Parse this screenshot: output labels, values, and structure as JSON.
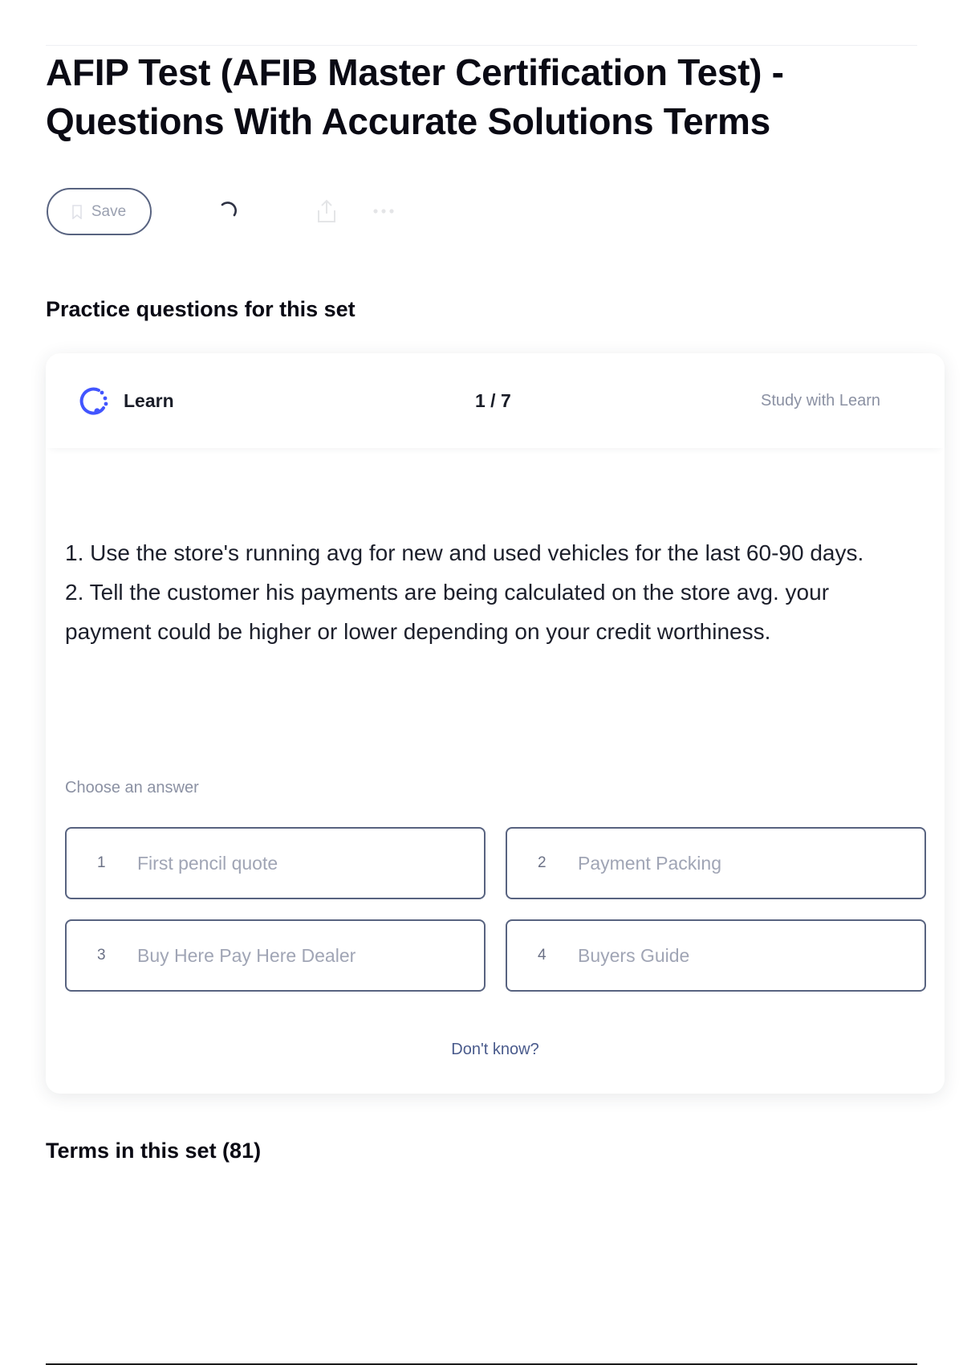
{
  "set": {
    "title": "AFIP Test (AFIB Master Certification Test) - Questions With Accurate Solutions Terms"
  },
  "toolbar": {
    "save_label": "Save"
  },
  "practice": {
    "heading": "Practice questions for this set",
    "mode_label": "Learn",
    "progress": "1 / 7",
    "study_link": "Study with Learn",
    "question": "1. Use the store's running avg for new and used vehicles for the last 60-90 days.\n2. Tell the customer his payments are being calculated on the store avg. your payment could be higher or lower depending on your credit worthiness.",
    "choose_label": "Choose an answer",
    "answers": [
      {
        "number": "1",
        "text": "First pencil quote"
      },
      {
        "number": "2",
        "text": "Payment Packing"
      },
      {
        "number": "3",
        "text": "Buy Here Pay Here Dealer"
      },
      {
        "number": "4",
        "text": "Buyers Guide"
      }
    ],
    "dont_know": "Don't know?"
  },
  "terms": {
    "heading": "Terms in this set (81)"
  },
  "colors": {
    "accent": "#4255ff",
    "border": "#586380",
    "muted_text": "#8b91a3",
    "link": "#4a5b8c"
  },
  "icons": [
    "bookmark-icon",
    "loading-icon",
    "share-icon",
    "more-icon",
    "learn-mode-icon"
  ]
}
